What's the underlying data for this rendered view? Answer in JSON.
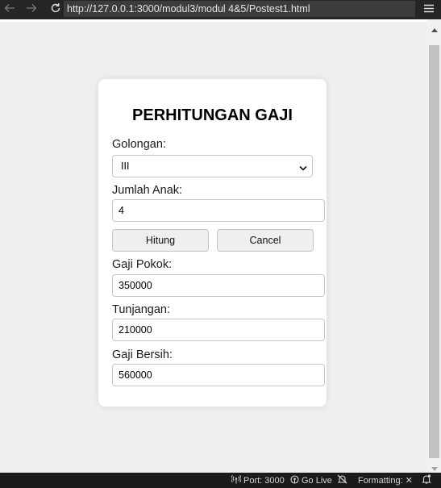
{
  "browser": {
    "url": "http://127.0.0.1:3000/modul3/modul 4&5/Postest1.html"
  },
  "form": {
    "title": "PERHITUNGAN GAJI",
    "golongan_label": "Golongan:",
    "golongan_value": "III",
    "jumlah_anak_label": "Jumlah Anak:",
    "jumlah_anak_value": "4",
    "hitung_label": "Hitung",
    "cancel_label": "Cancel",
    "gaji_pokok_label": "Gaji Pokok:",
    "gaji_pokok_value": "350000",
    "tunjangan_label": "Tunjangan:",
    "tunjangan_value": "210000",
    "gaji_bersih_label": "Gaji Bersih:",
    "gaji_bersih_value": "560000"
  },
  "statusbar": {
    "port": "Port: 3000",
    "go_live": "Go Live",
    "formatting": "Formatting:",
    "formatting_state": "✕"
  },
  "colors": {
    "toolbar_bg": "#252526",
    "page_bg": "#efefef",
    "card_bg": "#ffffff",
    "statusbar_bg": "#1b1b1c"
  }
}
